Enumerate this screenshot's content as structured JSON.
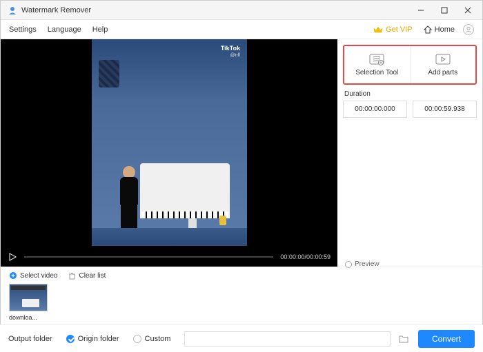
{
  "titlebar": {
    "title": "Watermark Remover"
  },
  "menubar": {
    "settings": "Settings",
    "language": "Language",
    "help": "Help",
    "get_vip": "Get VIP",
    "home": "Home"
  },
  "video": {
    "watermark_brand": "TikTok",
    "watermark_user": "@nfl",
    "time_display": "00:00:00/00:00:59"
  },
  "side": {
    "selection_tool": "Selection Tool",
    "add_parts": "Add parts",
    "duration_label": "Duration",
    "start_time": "00:00:00.000",
    "end_time": "00:00:59.938",
    "preview": "Preview"
  },
  "filelist": {
    "select_video": "Select video",
    "clear_list": "Clear list",
    "thumb_name": "downloa..."
  },
  "footer": {
    "output_folder": "Output folder",
    "origin_folder": "Origin folder",
    "custom": "Custom",
    "convert": "Convert"
  }
}
